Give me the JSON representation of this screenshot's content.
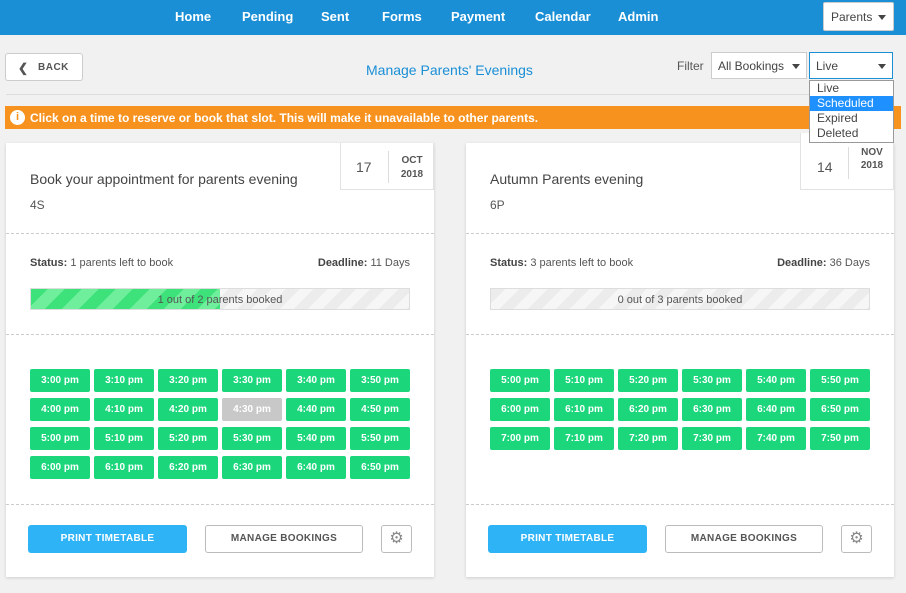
{
  "nav": {
    "items": [
      "Home",
      "Pending",
      "Sent",
      "Forms",
      "Payment",
      "Calendar",
      "Admin"
    ],
    "role": "Parents"
  },
  "header": {
    "back": "BACK",
    "title": "Manage Parents' Evenings",
    "filter_label": "Filter",
    "bookings_filter": "All Bookings",
    "status_filter": "Live",
    "status_options": [
      "Live",
      "Scheduled",
      "Expired",
      "Deleted"
    ],
    "highlighted_option": "Scheduled"
  },
  "banner": {
    "icon": "info-icon",
    "text": "Click on a time to reserve or book that slot. This will make it unavailable to other parents."
  },
  "cards": [
    {
      "title": "Book your appointment for parents evening",
      "class": "4S",
      "day": "17",
      "month": "OCT",
      "year": "2018",
      "status_label": "Status:",
      "status_value": "1 parents left to book",
      "deadline_label": "Deadline:",
      "deadline_value": "11 Days",
      "progress_text": "1 out of 2 parents booked",
      "progress_fraction": 0.5,
      "slots": [
        {
          "t": "3:00 pm",
          "taken": false
        },
        {
          "t": "3:10 pm",
          "taken": false
        },
        {
          "t": "3:20 pm",
          "taken": false
        },
        {
          "t": "3:30 pm",
          "taken": false
        },
        {
          "t": "3:40 pm",
          "taken": false
        },
        {
          "t": "3:50 pm",
          "taken": false
        },
        {
          "t": "4:00 pm",
          "taken": false
        },
        {
          "t": "4:10 pm",
          "taken": false
        },
        {
          "t": "4:20 pm",
          "taken": false
        },
        {
          "t": "4:30 pm",
          "taken": true
        },
        {
          "t": "4:40 pm",
          "taken": false
        },
        {
          "t": "4:50 pm",
          "taken": false
        },
        {
          "t": "5:00 pm",
          "taken": false
        },
        {
          "t": "5:10 pm",
          "taken": false
        },
        {
          "t": "5:20 pm",
          "taken": false
        },
        {
          "t": "5:30 pm",
          "taken": false
        },
        {
          "t": "5:40 pm",
          "taken": false
        },
        {
          "t": "5:50 pm",
          "taken": false
        },
        {
          "t": "6:00 pm",
          "taken": false
        },
        {
          "t": "6:10 pm",
          "taken": false
        },
        {
          "t": "6:20 pm",
          "taken": false
        },
        {
          "t": "6:30 pm",
          "taken": false
        },
        {
          "t": "6:40 pm",
          "taken": false
        },
        {
          "t": "6:50 pm",
          "taken": false
        }
      ],
      "print_label": "PRINT TIMETABLE",
      "manage_label": "MANAGE BOOKINGS"
    },
    {
      "title": "Autumn Parents evening",
      "class": "6P",
      "day": "14",
      "month": "NOV",
      "year": "2018",
      "status_label": "Status:",
      "status_value": "3 parents left to book",
      "deadline_label": "Deadline:",
      "deadline_value": "36 Days",
      "progress_text": "0 out of 3 parents booked",
      "progress_fraction": 0,
      "slots": [
        {
          "t": "5:00 pm",
          "taken": false
        },
        {
          "t": "5:10 pm",
          "taken": false
        },
        {
          "t": "5:20 pm",
          "taken": false
        },
        {
          "t": "5:30 pm",
          "taken": false
        },
        {
          "t": "5:40 pm",
          "taken": false
        },
        {
          "t": "5:50 pm",
          "taken": false
        },
        {
          "t": "6:00 pm",
          "taken": false
        },
        {
          "t": "6:10 pm",
          "taken": false
        },
        {
          "t": "6:20 pm",
          "taken": false
        },
        {
          "t": "6:30 pm",
          "taken": false
        },
        {
          "t": "6:40 pm",
          "taken": false
        },
        {
          "t": "6:50 pm",
          "taken": false
        },
        {
          "t": "7:00 pm",
          "taken": false
        },
        {
          "t": "7:10 pm",
          "taken": false
        },
        {
          "t": "7:20 pm",
          "taken": false
        },
        {
          "t": "7:30 pm",
          "taken": false
        },
        {
          "t": "7:40 pm",
          "taken": false
        },
        {
          "t": "7:50 pm",
          "taken": false
        }
      ],
      "print_label": "PRINT TIMETABLE",
      "manage_label": "MANAGE BOOKINGS"
    }
  ]
}
